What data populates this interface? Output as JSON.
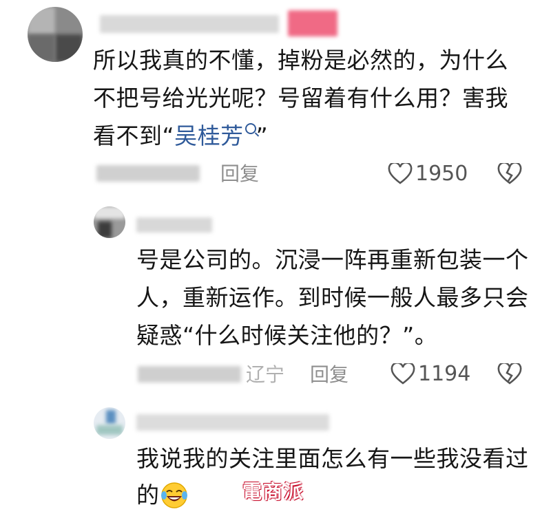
{
  "comments": [
    {
      "lines": [
        "所以我真的不懂，掉粉是必然的，为什么",
        "不把号给光光呢？号留着有什么用？害我"
      ],
      "last_prefix": "看不到“",
      "link_text": "吴桂芳",
      "last_suffix": "”",
      "reply_label": "回复",
      "like_count": "1950",
      "like_icon": "heart-outline-icon",
      "dislike_icon": "broken-heart-icon"
    },
    {
      "lines": [
        "号是公司的。沉浸一阵再重新包装一个",
        "人，重新运作。到时候一般人最多只会",
        "疑惑“什么时候关注他的？”。"
      ],
      "location": "辽宁",
      "reply_label": "回复",
      "like_count": "1194",
      "like_icon": "heart-outline-icon",
      "dislike_icon": "broken-heart-icon"
    },
    {
      "lines": [
        "我说我的关注里面怎么有一些我没看过",
        "的"
      ],
      "emoji_icon": "laughing-crying-emoji-icon"
    }
  ],
  "watermark": "電商派",
  "colors": {
    "link": "#2f5a9a",
    "meta": "#8e8e8e",
    "watermark": "#c8102e"
  }
}
